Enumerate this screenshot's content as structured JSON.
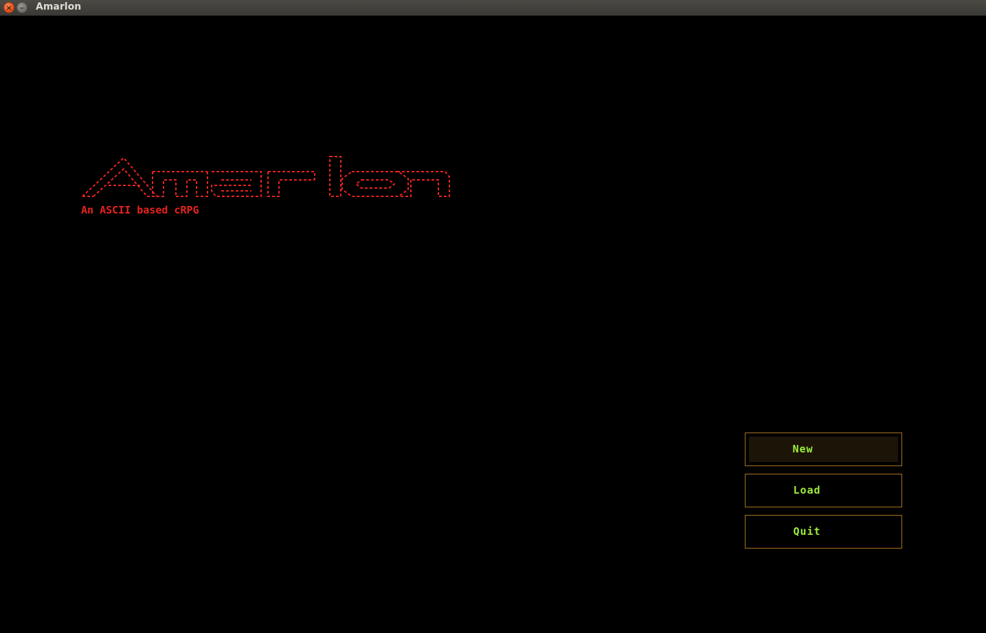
{
  "window": {
    "title": "Amarlon"
  },
  "logo": {
    "text": "Amarlon",
    "color": "#e8231d"
  },
  "subtitle": "An ASCII based cRPG",
  "menu": {
    "items": [
      {
        "label": "New",
        "selected": true
      },
      {
        "label": "Load",
        "selected": false
      },
      {
        "label": "Quit",
        "selected": false
      }
    ],
    "label_color": "#9df03a",
    "border_color": "#a8741f"
  }
}
